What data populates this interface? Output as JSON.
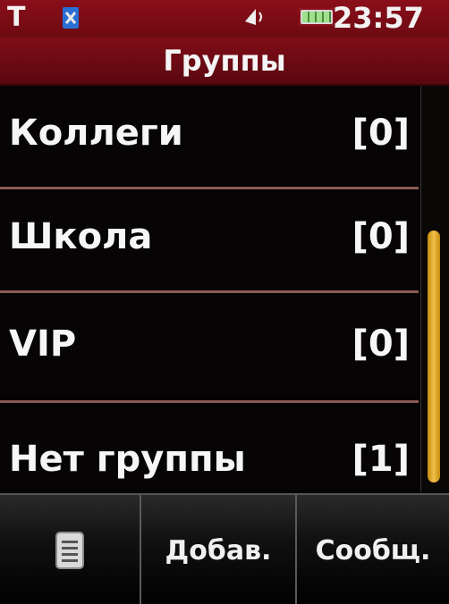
{
  "status_bar": {
    "carrier_letter": "T",
    "time": "23:57",
    "icons": [
      "sim-icon",
      "vibrate-icon",
      "battery-icon"
    ]
  },
  "title": "Группы",
  "groups": [
    {
      "name": "Коллеги",
      "count": "[0]"
    },
    {
      "name": "Школа",
      "count": "[0]"
    },
    {
      "name": "VIP",
      "count": "[0]"
    },
    {
      "name": "Нет группы",
      "count": "[1]"
    }
  ],
  "softkeys": {
    "menu_icon": "document-list-icon",
    "add_label": "Добав.",
    "message_label": "Сообщ."
  },
  "colors": {
    "header_red": "#8a0f1a",
    "divider": "#8a5a55",
    "scroll_thumb": "#f1c04a"
  }
}
